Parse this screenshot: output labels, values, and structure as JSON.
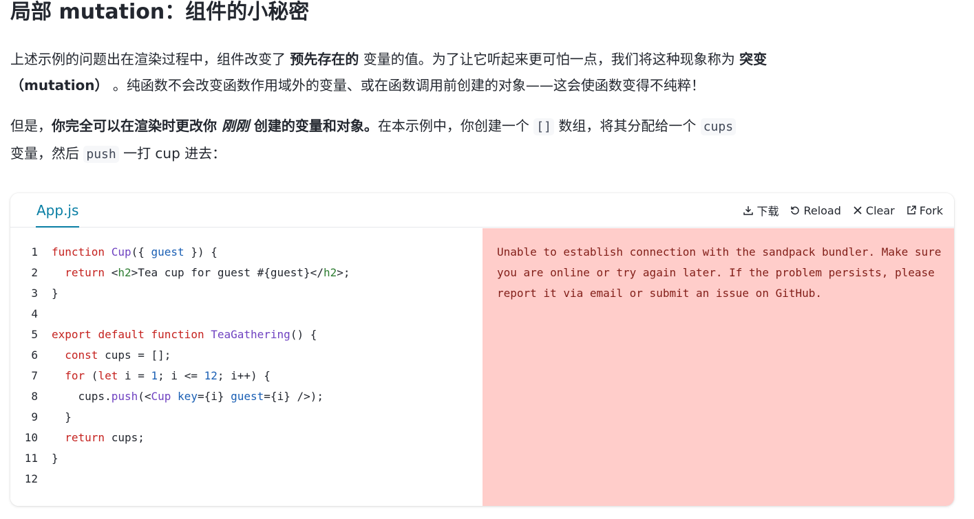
{
  "title": "局部 mutation：组件的小秘密",
  "p1": {
    "t1": "上述示例的问题出在渲染过程中，组件改变了 ",
    "b1": "预先存在的",
    "t2": " 变量的值。为了让它听起来更可怕一点，我们将这种现象称为 ",
    "b2": "突变（mutation）",
    "t3": " 。纯函数不会改变函数作用域外的变量、或在函数调用前创建的对象——这会使函数变得不纯粹！"
  },
  "p2": {
    "t1": "但是，",
    "b1": "你完全可以在渲染时更改你 ",
    "i1": "刚刚",
    "b2": " 创建的变量和对象。",
    "t2": "在本示例中，你创建一个 ",
    "c1": "[]",
    "t3": " 数组，将其分配给一个 ",
    "c2": "cups",
    "t4": " 变量，然后 ",
    "c3": "push",
    "t5": " 一打 cup 进去："
  },
  "sandpack": {
    "tab": "App.js",
    "actions": {
      "download": "下载",
      "reload": "Reload",
      "clear": "Clear",
      "fork": "Fork"
    },
    "line_numbers": [
      "1",
      "2",
      "3",
      "4",
      "5",
      "6",
      "7",
      "8",
      "9",
      "10",
      "11",
      "12"
    ],
    "error": "Unable to establish connection with the sandpack bundler. Make sure you are online or try again later. If the problem persists, please report it via email or submit an issue on GitHub."
  },
  "code": {
    "l1": [
      "function",
      " ",
      "Cup",
      "({ ",
      "guest",
      " }) {"
    ],
    "l2": [
      "  ",
      "return",
      " <",
      "h2",
      ">Tea cup for guest #{guest}</",
      "h2",
      ">;"
    ],
    "l3": [
      "}"
    ],
    "l5": [
      "export",
      " ",
      "default",
      " ",
      "function",
      " ",
      "TeaGathering",
      "() {"
    ],
    "l6": [
      "  ",
      "const",
      " cups = [];"
    ],
    "l7": [
      "  ",
      "for",
      " (",
      "let",
      " i = ",
      "1",
      "; i <= ",
      "12",
      "; i++) {"
    ],
    "l8": [
      "    cups.",
      "push",
      "(<",
      "Cup",
      " ",
      "key",
      "={i} ",
      "guest",
      "={i} />);"
    ],
    "l9": [
      "  }"
    ],
    "l10": [
      "  ",
      "return",
      " cups;"
    ],
    "l11": [
      "}"
    ]
  }
}
